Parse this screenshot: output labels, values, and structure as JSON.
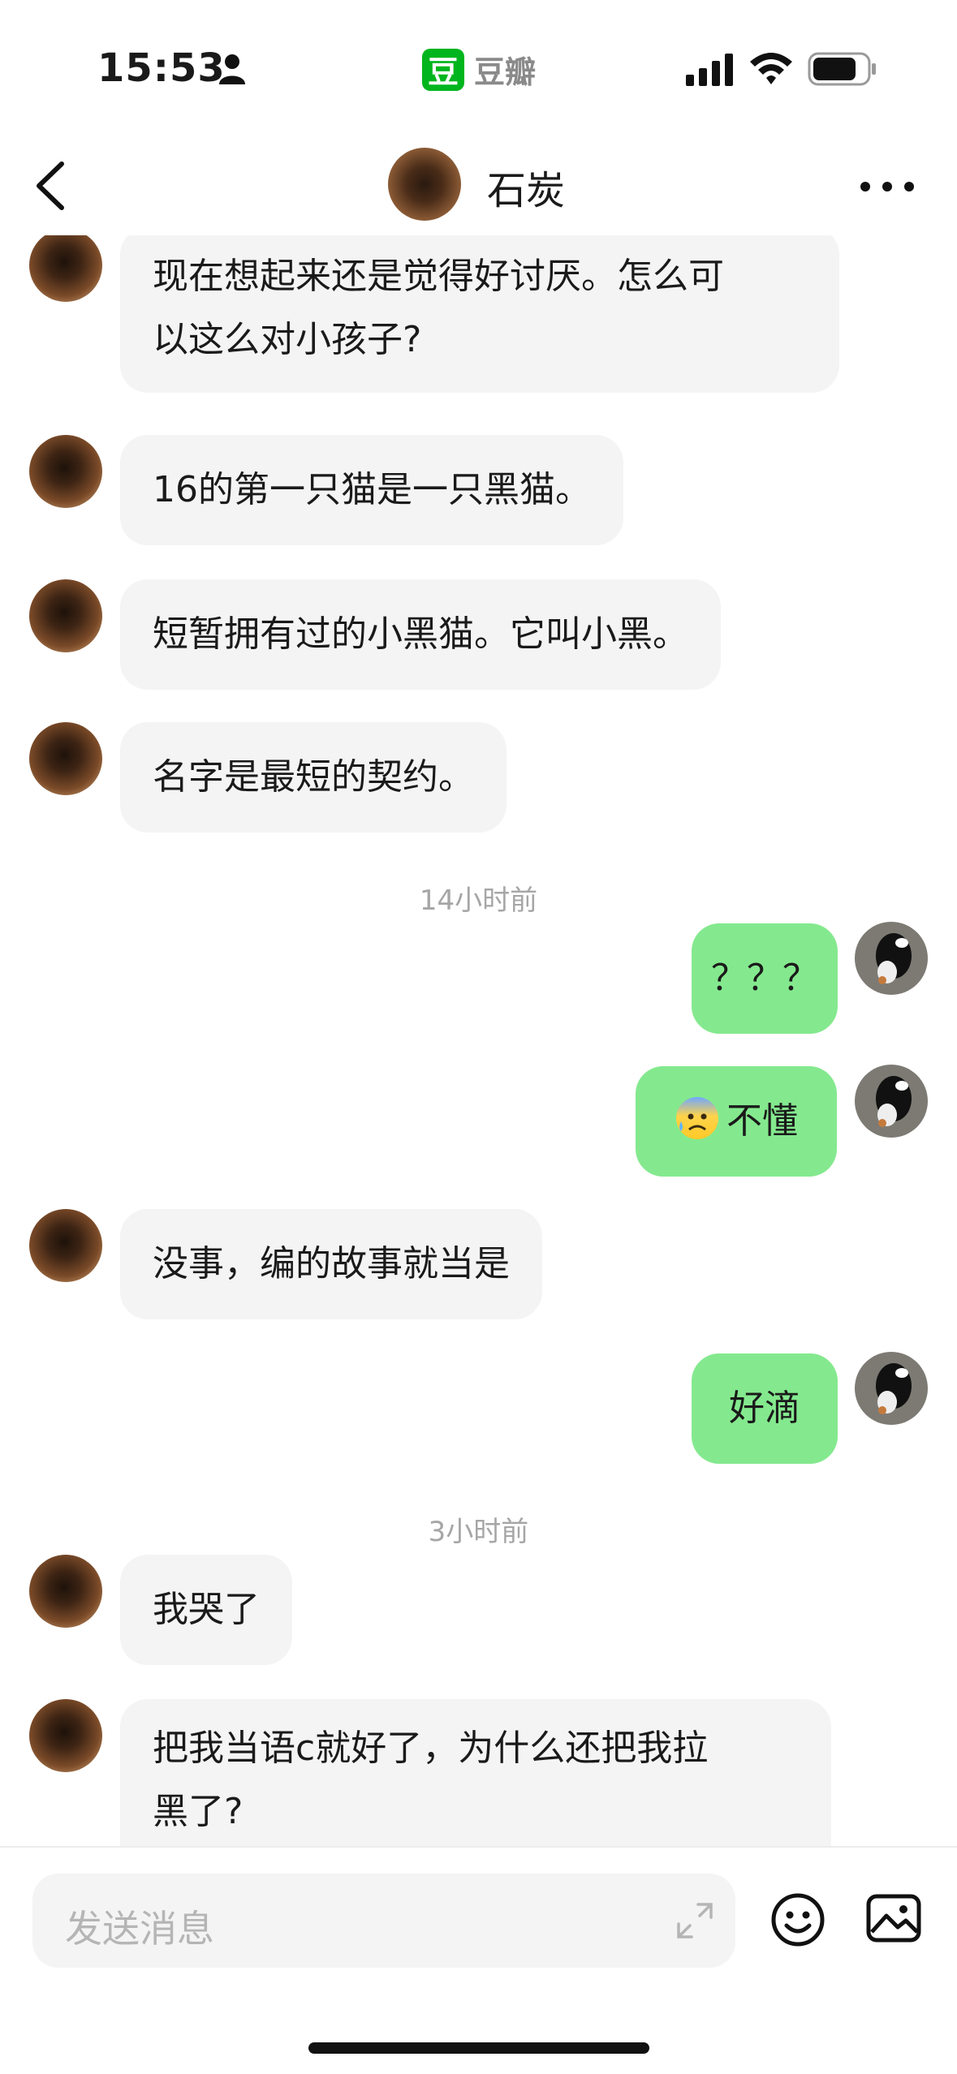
{
  "status_bar": {
    "time": "15:53",
    "app_logo_char": "豆",
    "app_name": "豆瓣"
  },
  "nav": {
    "title": "石炭"
  },
  "messages": [
    {
      "side": "in",
      "text_lines": [
        "现在想起来还是觉得好讨厌。怎么可",
        "以这么对小孩子?"
      ]
    },
    {
      "side": "in",
      "text": "16的第一只猫是一只黑猫。"
    },
    {
      "side": "in",
      "text": "短暂拥有过的小黑猫。它叫小黑。"
    },
    {
      "side": "in",
      "text": "名字是最短的契约。"
    },
    {
      "type": "timestamp",
      "text": "14小时前"
    },
    {
      "side": "out",
      "text": "？？？"
    },
    {
      "side": "out",
      "emoji": "anxious-face-with-sweat-icon",
      "text": "不懂"
    },
    {
      "side": "in",
      "text": "没事，编的故事就当是"
    },
    {
      "side": "out",
      "text": "好滴"
    },
    {
      "type": "timestamp",
      "text": "3小时前"
    },
    {
      "side": "in",
      "text": "我哭了"
    },
    {
      "side": "in",
      "text_lines": [
        "把我当语c就好了，为什么还把我拉",
        "黑了?"
      ]
    }
  ],
  "input": {
    "placeholder": "发送消息"
  },
  "colors": {
    "outgoing_bubble": "#84e98e",
    "incoming_bubble": "#f4f4f4",
    "app_green": "#00b51d"
  }
}
